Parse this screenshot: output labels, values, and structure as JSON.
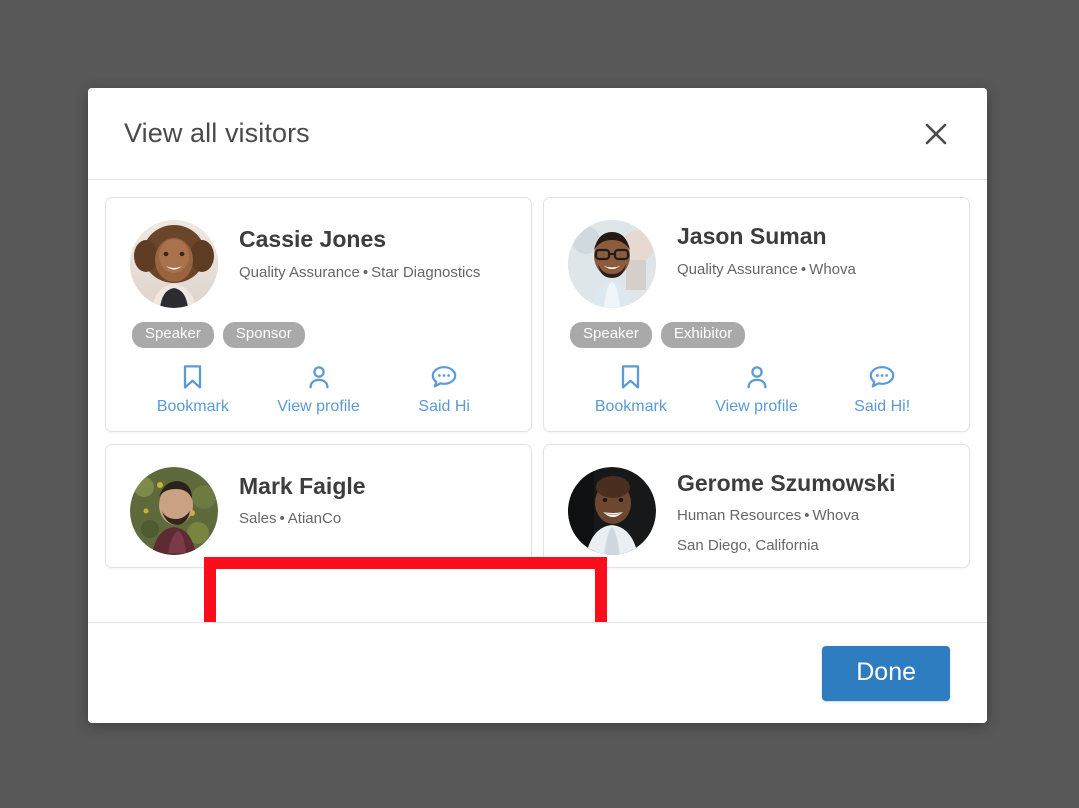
{
  "backdrop_color": "#585858",
  "modal": {
    "title": "View all visitors",
    "close_label": "×"
  },
  "visitors": [
    {
      "name": "Cassie Jones",
      "role": "Quality Assurance",
      "separator": "•",
      "organization": "Star Diagnostics",
      "location": "",
      "badges": [
        "Speaker",
        "Sponsor"
      ],
      "actions": [
        {
          "icon": "bookmark-icon",
          "label": "Bookmark"
        },
        {
          "icon": "person-icon",
          "label": "View profile"
        },
        {
          "icon": "chat-bubble-icon",
          "label": "Said Hi"
        }
      ]
    },
    {
      "name": "Jason Suman",
      "role": "Quality Assurance",
      "separator": "•",
      "organization": "Whova",
      "location": "",
      "badges": [
        "Speaker",
        "Exhibitor"
      ],
      "actions": [
        {
          "icon": "bookmark-icon",
          "label": "Bookmark"
        },
        {
          "icon": "person-icon",
          "label": "View profile"
        },
        {
          "icon": "chat-bubble-icon",
          "label": "Said Hi!"
        }
      ]
    },
    {
      "name": "Mark Faigle",
      "role": "Sales",
      "separator": "•",
      "organization": "AtianCo",
      "location": "",
      "badges": [],
      "actions": []
    },
    {
      "name": "Gerome Szumowski",
      "role": "Human Resources",
      "separator": "•",
      "organization": "Whova",
      "location": "San Diego, California",
      "badges": [],
      "actions": []
    }
  ],
  "footer": {
    "done_label": "Done"
  },
  "annotation": {
    "highlight_color": "#fc0d1b",
    "target": "card-0-actions"
  },
  "colors": {
    "accent_link": "#5b9bd5",
    "primary_button": "#2e7dc0",
    "badge_background": "#a9a9a9",
    "title_text": "#4a4a4a"
  }
}
